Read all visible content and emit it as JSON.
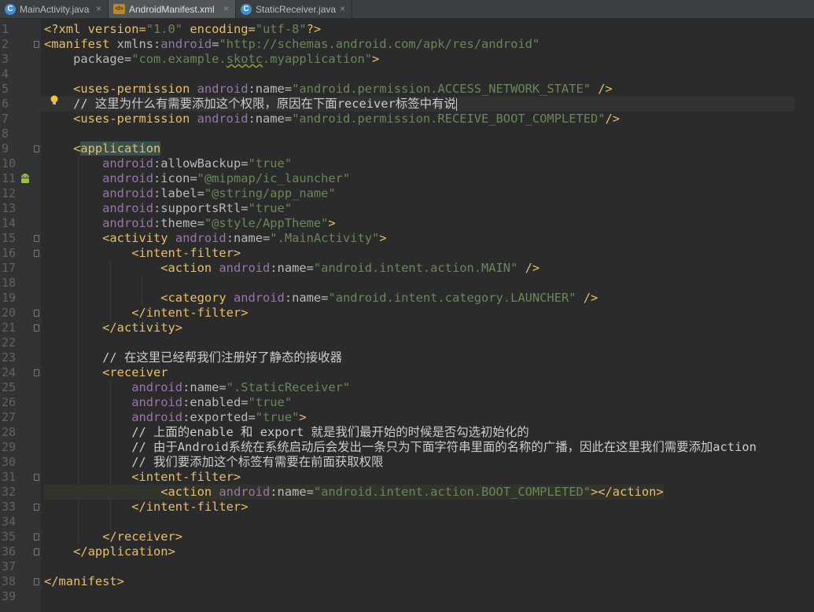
{
  "tabs": [
    {
      "label": "MainActivity.java",
      "icon": "java-class-icon",
      "active": false
    },
    {
      "label": "AndroidManifest.xml",
      "icon": "xml-file-icon",
      "active": true
    },
    {
      "label": "StaticReceiver.java",
      "icon": "java-class-icon",
      "active": false
    }
  ],
  "close_glyph": "×",
  "code": {
    "lines": [
      [
        [
          "t-plain",
          "<?xml version="
        ],
        [
          "t-val",
          "\"1.0\""
        ],
        [
          "t-plain",
          " encoding="
        ],
        [
          "t-val",
          "\"utf-8\""
        ],
        [
          "t-plain",
          "?>"
        ]
      ],
      [
        [
          "t-tag",
          "<manifest "
        ],
        [
          "t-attr",
          "xmlns:"
        ],
        [
          "t-ns",
          "android"
        ],
        [
          "t-attr",
          "="
        ],
        [
          "t-val",
          "\"http://schemas.android.com/apk/res/android\""
        ]
      ],
      [
        [
          "t-txt",
          "    "
        ],
        [
          "t-attr",
          "package="
        ],
        [
          "t-val",
          "\"com.example."
        ],
        [
          "t-val squiggle",
          "skotc"
        ],
        [
          "t-val",
          ".myapplication\""
        ],
        [
          "t-tag",
          ">"
        ]
      ],
      [],
      [
        [
          "t-txt",
          "    "
        ],
        [
          "t-tag",
          "<uses-permission "
        ],
        [
          "t-ns",
          "android"
        ],
        [
          "t-attr",
          ":name="
        ],
        [
          "t-val",
          "\"android.permission.ACCESS_NETWORK_STATE\""
        ],
        [
          "t-tag",
          " />"
        ]
      ],
      [
        [
          "t-txt",
          "    "
        ],
        [
          "t-com",
          "// 这里为什么有需要添加这个权限，原因在下面receiver标签中有说"
        ]
      ],
      [
        [
          "t-txt",
          "    "
        ],
        [
          "t-tag",
          "<uses-permission "
        ],
        [
          "t-ns",
          "android"
        ],
        [
          "t-attr",
          ":name="
        ],
        [
          "t-val",
          "\"android.permission.RECEIVE_BOOT_COMPLETED\""
        ],
        [
          "t-tag",
          "/>"
        ]
      ],
      [],
      [
        [
          "t-txt",
          "    "
        ],
        [
          "t-tag",
          "<"
        ],
        [
          "t-tag hl",
          "application"
        ]
      ],
      [
        [
          "t-txt",
          "        "
        ],
        [
          "t-ns",
          "android"
        ],
        [
          "t-attr",
          ":allowBackup="
        ],
        [
          "t-val",
          "\"true\""
        ]
      ],
      [
        [
          "t-txt",
          "        "
        ],
        [
          "t-ns",
          "android"
        ],
        [
          "t-attr",
          ":icon="
        ],
        [
          "t-val",
          "\"@mipmap/ic_launcher\""
        ]
      ],
      [
        [
          "t-txt",
          "        "
        ],
        [
          "t-ns",
          "android"
        ],
        [
          "t-attr",
          ":label="
        ],
        [
          "t-val",
          "\"@string/app_name\""
        ]
      ],
      [
        [
          "t-txt",
          "        "
        ],
        [
          "t-ns",
          "android"
        ],
        [
          "t-attr",
          ":supportsRtl="
        ],
        [
          "t-val",
          "\"true\""
        ]
      ],
      [
        [
          "t-txt",
          "        "
        ],
        [
          "t-ns",
          "android"
        ],
        [
          "t-attr",
          ":theme="
        ],
        [
          "t-val",
          "\"@style/AppTheme\""
        ],
        [
          "t-tag",
          ">"
        ]
      ],
      [
        [
          "t-txt",
          "        "
        ],
        [
          "t-tag",
          "<activity "
        ],
        [
          "t-ns",
          "android"
        ],
        [
          "t-attr",
          ":name="
        ],
        [
          "t-val",
          "\".MainActivity\""
        ],
        [
          "t-tag",
          ">"
        ]
      ],
      [
        [
          "t-txt",
          "            "
        ],
        [
          "t-tag",
          "<intent-filter>"
        ]
      ],
      [
        [
          "t-txt",
          "                "
        ],
        [
          "t-tag",
          "<action "
        ],
        [
          "t-ns",
          "android"
        ],
        [
          "t-attr",
          ":name="
        ],
        [
          "t-val",
          "\"android.intent.action.MAIN\""
        ],
        [
          "t-tag",
          " />"
        ]
      ],
      [],
      [
        [
          "t-txt",
          "                "
        ],
        [
          "t-tag",
          "<category "
        ],
        [
          "t-ns",
          "android"
        ],
        [
          "t-attr",
          ":name="
        ],
        [
          "t-val",
          "\"android.intent.category.LAUNCHER\""
        ],
        [
          "t-tag",
          " />"
        ]
      ],
      [
        [
          "t-txt",
          "            "
        ],
        [
          "t-tag",
          "</intent-filter>"
        ]
      ],
      [
        [
          "t-txt",
          "        "
        ],
        [
          "t-tag",
          "</activity>"
        ]
      ],
      [],
      [
        [
          "t-txt",
          "        "
        ],
        [
          "t-com",
          "// 在这里已经帮我们注册好了静态的接收器"
        ]
      ],
      [
        [
          "t-txt",
          "        "
        ],
        [
          "t-tag",
          "<receiver"
        ]
      ],
      [
        [
          "t-txt",
          "            "
        ],
        [
          "t-ns",
          "android"
        ],
        [
          "t-attr",
          ":name="
        ],
        [
          "t-val",
          "\".StaticReceiver\""
        ]
      ],
      [
        [
          "t-txt",
          "            "
        ],
        [
          "t-ns",
          "android"
        ],
        [
          "t-attr",
          ":enabled="
        ],
        [
          "t-val",
          "\"true\""
        ]
      ],
      [
        [
          "t-txt",
          "            "
        ],
        [
          "t-ns",
          "android"
        ],
        [
          "t-attr",
          ":exported="
        ],
        [
          "t-val",
          "\"true\""
        ],
        [
          "t-tag",
          ">"
        ]
      ],
      [
        [
          "t-txt",
          "            "
        ],
        [
          "t-com",
          "// 上面的enable 和 export 就是我们最开始的时候是否勾选初始化的"
        ]
      ],
      [
        [
          "t-txt",
          "            "
        ],
        [
          "t-com",
          "// 由于Android系统在系统启动后会发出一条只为下面字符串里面的名称的广播，因此在这里我们需要添加action"
        ]
      ],
      [
        [
          "t-txt",
          "            "
        ],
        [
          "t-com",
          "// 我们要添加这个标签有需要在前面获取权限"
        ]
      ],
      [
        [
          "t-txt",
          "            "
        ],
        [
          "t-tag",
          "<intent-filter>"
        ]
      ],
      [
        [
          "t-txt",
          "                "
        ],
        [
          "t-tag",
          "<action "
        ],
        [
          "t-ns",
          "android"
        ],
        [
          "t-attr",
          ":name="
        ],
        [
          "t-val",
          "\"android.intent.action.BOOT_COMPLETED\""
        ],
        [
          "t-tag",
          "></action>"
        ]
      ],
      [
        [
          "t-txt",
          "            "
        ],
        [
          "t-tag",
          "</intent-filter>"
        ]
      ],
      [],
      [
        [
          "t-txt",
          "        "
        ],
        [
          "t-tag",
          "</receiver>"
        ]
      ],
      [
        [
          "t-txt",
          "    "
        ],
        [
          "t-tag",
          "</application>"
        ]
      ],
      [],
      [
        [
          "t-tag",
          "</manifest>"
        ]
      ],
      []
    ]
  }
}
